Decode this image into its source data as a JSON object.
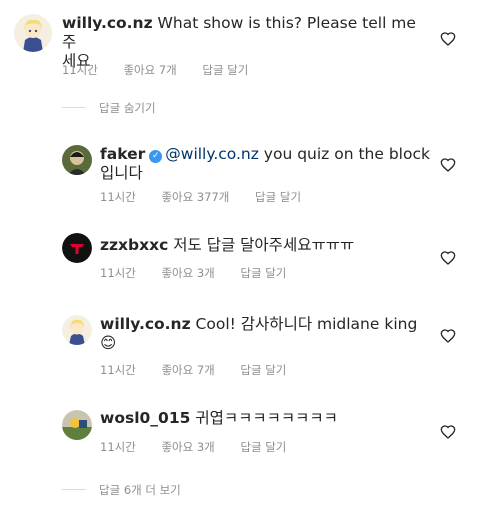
{
  "comments": [
    {
      "username": "willy.co.nz",
      "text_line1": "What show is this? Please tell me 주",
      "text_line2": "세요",
      "time": "11시간",
      "likes": "좋아요 7개",
      "reply": "답글 달기"
    },
    {
      "username": "faker",
      "mention": "@willy.co.nz",
      "text_line1": " you quiz on the block",
      "text_line2": "입니다",
      "time": "11시간",
      "likes": "좋아요 377개",
      "reply": "답글 달기"
    },
    {
      "username": "zzxbxxc",
      "text_line1": "저도 답글 달아주세요ㅠㅠㅠ",
      "time": "11시간",
      "likes": "좋아요 3개",
      "reply": "답글 달기"
    },
    {
      "username": "willy.co.nz",
      "text_line1": "Cool! 감사하니다 midlane king",
      "emoji": "😊",
      "time": "11시간",
      "likes": "좋아요 7개",
      "reply": "답글 달기"
    },
    {
      "username": "wosl0_015",
      "text_line1": "귀엽ㅋㅋㅋㅋㅋㅋㅋㅋ",
      "time": "11시간",
      "likes": "좋아요 3개",
      "reply": "답글 달기"
    }
  ],
  "hide_replies": "답글 숨기기",
  "view_more_replies": "답글 6개 더 보기",
  "colors": {
    "verified": "#3897f0",
    "meta": "#8e8e8e",
    "divider": "#dbdbdb"
  }
}
